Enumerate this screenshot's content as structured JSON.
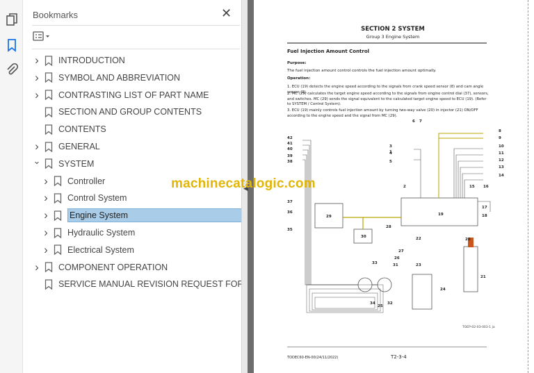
{
  "rail": {
    "icons": [
      "pages-icon",
      "bookmark-icon",
      "attachment-icon"
    ],
    "accent": "#1a73e8"
  },
  "panel": {
    "title": "Bookmarks",
    "close": "✕"
  },
  "bookmarks": [
    {
      "label": "INTRODUCTION",
      "level": 0,
      "expandable": true,
      "expanded": false
    },
    {
      "label": "SYMBOL AND ABBREVIATION",
      "level": 0,
      "expandable": true,
      "expanded": false
    },
    {
      "label": "CONTRASTING LIST OF PART NAME",
      "level": 0,
      "expandable": true,
      "expanded": false
    },
    {
      "label": "SECTION AND GROUP CONTENTS",
      "level": 0,
      "expandable": false
    },
    {
      "label": "CONTENTS",
      "level": 0,
      "expandable": false
    },
    {
      "label": "GENERAL",
      "level": 0,
      "expandable": true,
      "expanded": false
    },
    {
      "label": "SYSTEM",
      "level": 0,
      "expandable": true,
      "expanded": true
    },
    {
      "label": "Controller",
      "level": 1,
      "expandable": true,
      "expanded": false
    },
    {
      "label": "Control System",
      "level": 1,
      "expandable": true,
      "expanded": false
    },
    {
      "label": "Engine System",
      "level": 1,
      "expandable": true,
      "expanded": false,
      "selected": true
    },
    {
      "label": "Hydraulic System",
      "level": 1,
      "expandable": true,
      "expanded": false
    },
    {
      "label": "Electrical System",
      "level": 1,
      "expandable": true,
      "expanded": false
    },
    {
      "label": "COMPONENT OPERATION",
      "level": 0,
      "expandable": true,
      "expanded": false
    },
    {
      "label": "SERVICE MANUAL REVISION REQUEST FORM",
      "level": 0,
      "expandable": false
    }
  ],
  "selected_color": "#a9cde9",
  "doc": {
    "section": "SECTION 2 SYSTEM",
    "group": "Group 3 Engine System",
    "heading": "Fuel Injection Amount Control",
    "purpose_label": "Purpose:",
    "purpose": "The fuel injection amount control controls the fuel injection amount optimally.",
    "operation_label": "Operation:",
    "ops": [
      "1.  ECU (19) detects the engine speed according to the signals from crank speed sensor (8) and cam angle sensor (9).",
      "2.  MC (29) calculates the target engine speed according to the signals from engine control dial (37), sensors, and switches. MC (29) sends the signal equivalent to the calculated target engine speed to ECU (19). (Refer to SYSTEM / Control System).",
      "3.  ECU (19) mainly controls fuel injection amount by turning two-way valve (20) in injector (21) ON/OFF according to the engine speed and the signal from MC (29)."
    ],
    "figure_id": "TOEP-02-03-003-1 ja",
    "footer_left": "TODEC60-EN-00(24/11/2022)",
    "page_number": "T2-3-4",
    "diagram_labels": [
      "1",
      "2",
      "3",
      "4",
      "5",
      "6",
      "7",
      "8",
      "9",
      "10",
      "11",
      "12",
      "13",
      "14",
      "15",
      "16",
      "17",
      "18",
      "19",
      "20",
      "21",
      "22",
      "23",
      "24",
      "25",
      "26",
      "27",
      "28",
      "29",
      "30",
      "31",
      "32",
      "33",
      "34",
      "35",
      "36",
      "37",
      "38",
      "39",
      "40",
      "41",
      "42"
    ]
  },
  "watermark": "machinecatalogic.com",
  "watermark_color": "#e3b505"
}
